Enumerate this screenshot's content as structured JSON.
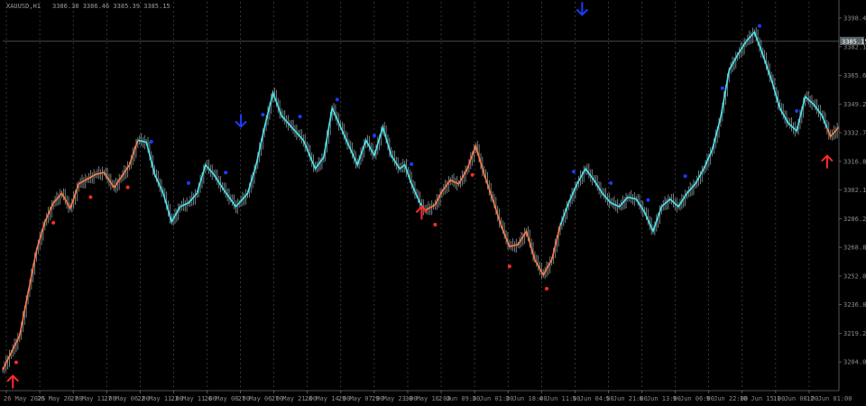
{
  "header": {
    "symbol_label": "XAUUSD,H1",
    "ohlc_label": "3386.38 3386.46 3385.39 3385.15"
  },
  "colors": {
    "background": "#000000",
    "candles": "#7d8a8c",
    "grid": "#555555",
    "uptrend_line": "#ff7a45",
    "downtrend_line": "#49e6ef",
    "up_dot": "#ff2a2a",
    "down_dot": "#1c3cff",
    "up_arrow": "#ff2a2a",
    "down_arrow": "#1c3cff",
    "current_price_bg": "#5a6468",
    "current_price_line": "#6b7478",
    "axis_text": "#8a8a8a"
  },
  "price_axis": {
    "labels": [
      "3398.45",
      "3382.10",
      "3365.65",
      "3349.20",
      "3332.75",
      "3316.80",
      "3302.18",
      "3286.20",
      "3268.85",
      "3252.80",
      "3236.88",
      "3219.20",
      "3204.05"
    ],
    "current_price_label": "3385.15"
  },
  "time_axis": {
    "labels": [
      "26 May 2025",
      "26 May 20:00",
      "27 May 11:00",
      "27 May 06:00",
      "22 May 11:00",
      "23 May 11:00",
      "26 May 08:00",
      "27 May 06:00",
      "27 May 21:00",
      "28 May 14:00",
      "29 May 07:00",
      "29 May 23:00",
      "30 May 16:00",
      "2 Jun 09:00",
      "3 Jun 01:00",
      "3 Jun 18:00",
      "4 Jun 11:00",
      "5 Jun 04:00",
      "5 Jun 21:00",
      "6 Jun 13:00",
      "9 Jun 06:00",
      "9 Jun 22:00",
      "10 Jun 15:00",
      "11 Jun 08:00",
      "12 Jun 01:00"
    ]
  },
  "chart_data": {
    "type": "line",
    "instrument": "XAUUSD,H1",
    "ylim": [
      3201,
      3406
    ],
    "grid": "vertical dashed",
    "series": [
      {
        "x_index": [
          0,
          10,
          20,
          25,
          30,
          35,
          40,
          45,
          55,
          60,
          66,
          75,
          80,
          85,
          90,
          95,
          100,
          105,
          110,
          115,
          120,
          125,
          130,
          138,
          145,
          150,
          155,
          160,
          165,
          170,
          178,
          185,
          190,
          195,
          200,
          205,
          210,
          215,
          220,
          225,
          230,
          235,
          238,
          242,
          247,
          250,
          256,
          260,
          265,
          270,
          275,
          280,
          285,
          290,
          295,
          300,
          305,
          310,
          315,
          320,
          325,
          330,
          335,
          340,
          345,
          350,
          355,
          360,
          365,
          370,
          375,
          380,
          385,
          390,
          395,
          400,
          405,
          410,
          415,
          420,
          425,
          430,
          435,
          440,
          445,
          450,
          455,
          460,
          465,
          470,
          475,
          480,
          485,
          490,
          495
        ],
        "close": [
          3212,
          3230,
          3275,
          3290,
          3300,
          3305,
          3297,
          3310,
          3315,
          3316,
          3308,
          3320,
          3333,
          3332,
          3315,
          3305,
          3290,
          3298,
          3300,
          3305,
          3320,
          3315,
          3308,
          3298,
          3305,
          3320,
          3340,
          3358,
          3346,
          3341,
          3333,
          3318,
          3324,
          3350,
          3340,
          3330,
          3320,
          3333,
          3325,
          3340,
          3325,
          3318,
          3320,
          3310,
          3300,
          3296,
          3299,
          3306,
          3312,
          3310,
          3318,
          3330,
          3315,
          3302,
          3288,
          3277,
          3278,
          3285,
          3270,
          3262,
          3270,
          3288,
          3300,
          3310,
          3318,
          3312,
          3305,
          3300,
          3298,
          3303,
          3302,
          3295,
          3285,
          3298,
          3302,
          3298,
          3305,
          3310,
          3318,
          3328,
          3345,
          3370,
          3378,
          3385,
          3390,
          3378,
          3365,
          3350,
          3342,
          3338,
          3356,
          3352,
          3346,
          3335,
          3340
        ]
      }
    ],
    "trend_segments": [
      {
        "trend": "up",
        "from_index": 0,
        "to_index": 80
      },
      {
        "trend": "down",
        "from_index": 80,
        "to_index": 248
      },
      {
        "trend": "up",
        "from_index": 248,
        "to_index": 330
      },
      {
        "trend": "down",
        "from_index": 330,
        "to_index": 488
      },
      {
        "trend": "up",
        "from_index": 488,
        "to_index": 495
      }
    ],
    "signals": [
      {
        "type": "buy",
        "index": 6,
        "price": 3206
      },
      {
        "type": "buy",
        "index": 248,
        "price": 3295
      },
      {
        "type": "sell",
        "index": 141,
        "price": 3343
      },
      {
        "type": "sell",
        "index": 343,
        "price": 3402
      },
      {
        "type": "buy",
        "index": 488,
        "price": 3322
      }
    ]
  }
}
